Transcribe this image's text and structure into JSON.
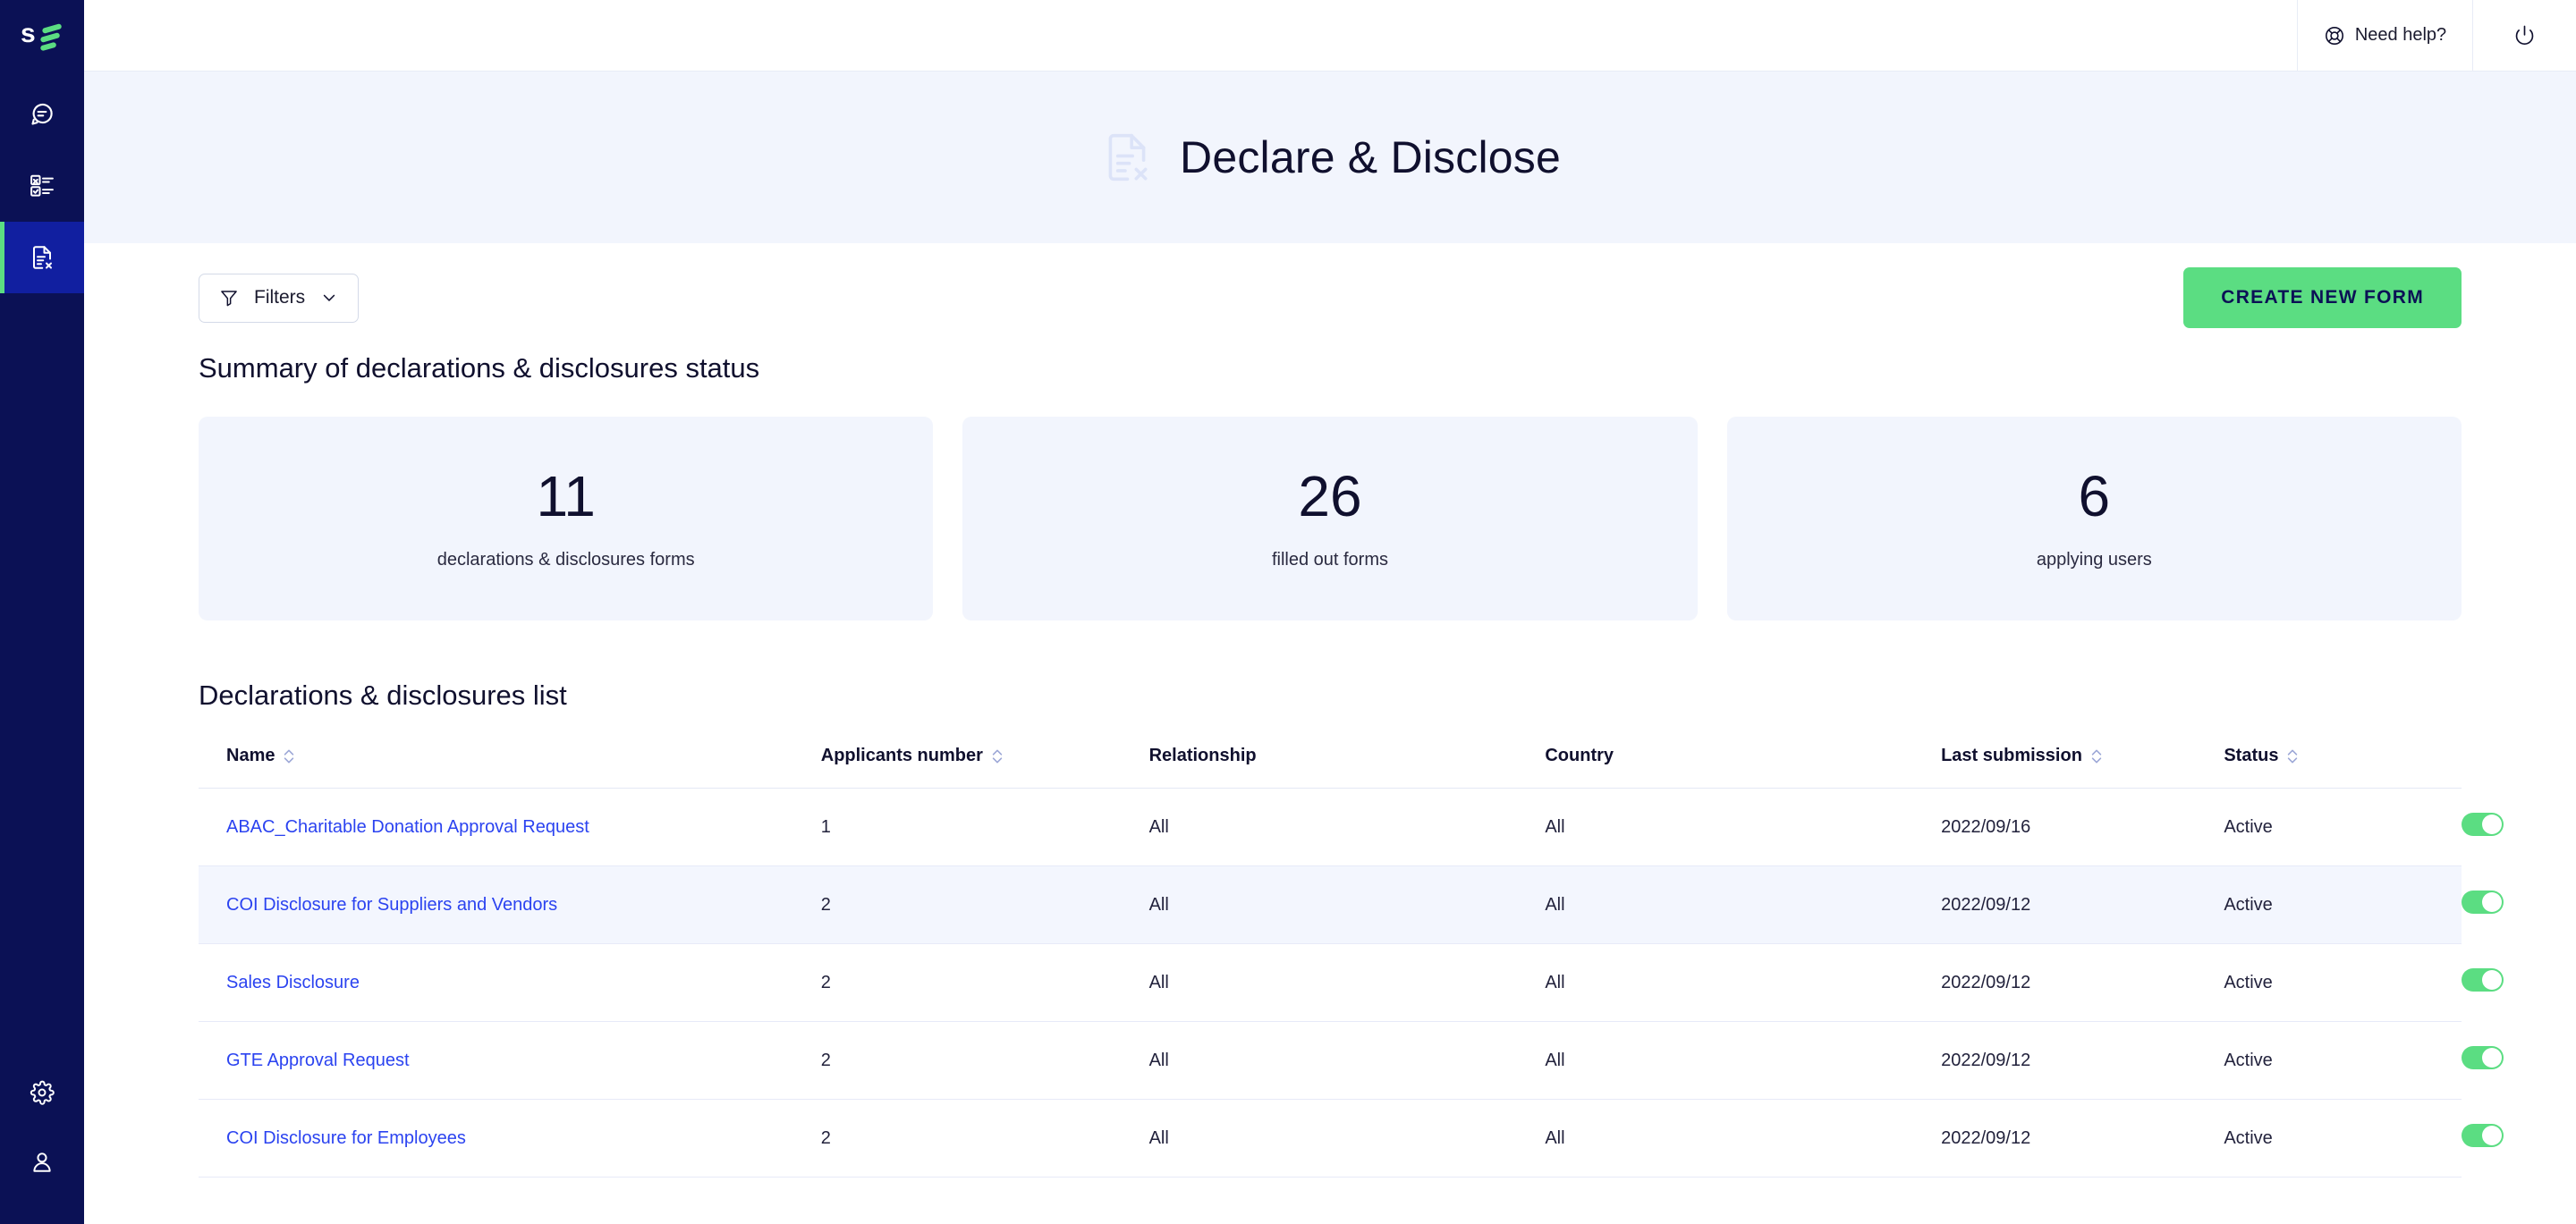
{
  "sidebar": {
    "logo_text": "s",
    "items": [
      {
        "name": "chat",
        "icon": "chat-bubble-icon",
        "active": false
      },
      {
        "name": "surveys",
        "icon": "checklist-icon",
        "active": false
      },
      {
        "name": "declare-disclose",
        "icon": "document-x-icon",
        "active": true
      }
    ],
    "bottom_items": [
      {
        "name": "settings",
        "icon": "gear-icon"
      },
      {
        "name": "account",
        "icon": "user-icon"
      }
    ]
  },
  "topbar": {
    "help_label": "Need help?",
    "help_icon": "lifebuoy-icon",
    "power_icon": "power-icon"
  },
  "banner": {
    "title": "Declare & Disclose",
    "icon": "document-x-icon"
  },
  "toolbar": {
    "filters_label": "Filters",
    "filters_icon": "funnel-icon",
    "filters_chevron": "chevron-down-icon",
    "create_label": "CREATE NEW FORM"
  },
  "summary": {
    "title": "Summary of declarations & disclosures status",
    "cards": [
      {
        "value": "11",
        "label": "declarations & disclosures forms"
      },
      {
        "value": "26",
        "label": "filled out forms"
      },
      {
        "value": "6",
        "label": "applying users"
      }
    ]
  },
  "list": {
    "title": "Declarations & disclosures list",
    "columns": [
      {
        "label": "Name",
        "sortable": true
      },
      {
        "label": "Applicants number",
        "sortable": true
      },
      {
        "label": "Relationship",
        "sortable": false
      },
      {
        "label": "Country",
        "sortable": false
      },
      {
        "label": "Last submission",
        "sortable": true
      },
      {
        "label": "Status",
        "sortable": true
      }
    ],
    "rows": [
      {
        "name": "ABAC_Charitable Donation Approval Request",
        "applicants": "1",
        "relationship": "All",
        "country": "All",
        "last_submission": "2022/09/16",
        "status": "Active",
        "toggle_on": true,
        "highlighted": false
      },
      {
        "name": "COI Disclosure for Suppliers and Vendors",
        "applicants": "2",
        "relationship": "All",
        "country": "All",
        "last_submission": "2022/09/12",
        "status": "Active",
        "toggle_on": true,
        "highlighted": true
      },
      {
        "name": "Sales Disclosure",
        "applicants": "2",
        "relationship": "All",
        "country": "All",
        "last_submission": "2022/09/12",
        "status": "Active",
        "toggle_on": true,
        "highlighted": false
      },
      {
        "name": "GTE Approval Request",
        "applicants": "2",
        "relationship": "All",
        "country": "All",
        "last_submission": "2022/09/12",
        "status": "Active",
        "toggle_on": true,
        "highlighted": false
      },
      {
        "name": "COI Disclosure for Employees",
        "applicants": "2",
        "relationship": "All",
        "country": "All",
        "last_submission": "2022/09/12",
        "status": "Active",
        "toggle_on": true,
        "highlighted": false
      }
    ]
  },
  "colors": {
    "sidebar_bg": "#0B1155",
    "sidebar_active_bg": "#111FA0",
    "accent_green": "#5BDD82",
    "banner_bg": "#F2F5FD",
    "link_blue": "#2B43F0",
    "text_dark": "#10102E"
  }
}
